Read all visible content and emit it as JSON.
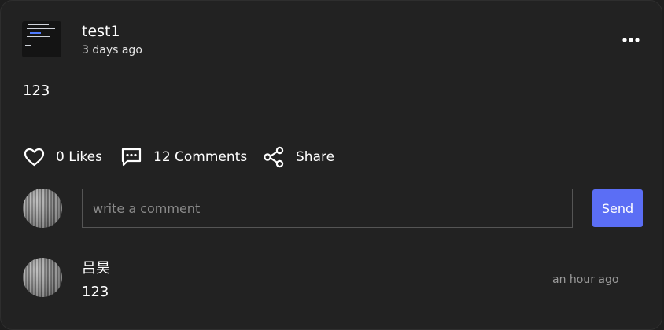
{
  "post": {
    "author": "test1",
    "time": "3 days ago",
    "content": "123",
    "avatar_icon": "thumbnail-image",
    "menu_icon": "more-horizontal-icon"
  },
  "actions": {
    "likes_label": "0 Likes",
    "comments_label": "12 Comments",
    "share_label": "Share"
  },
  "comment_form": {
    "placeholder": "write a comment",
    "value": "",
    "send_label": "Send",
    "send_color": "#5b6ef5"
  },
  "comments": [
    {
      "author": "吕昊",
      "text": "123",
      "time": "an hour ago"
    }
  ],
  "colors": {
    "card_bg": "#222222",
    "text": "#ffffff",
    "muted": "#9a9a9a"
  }
}
